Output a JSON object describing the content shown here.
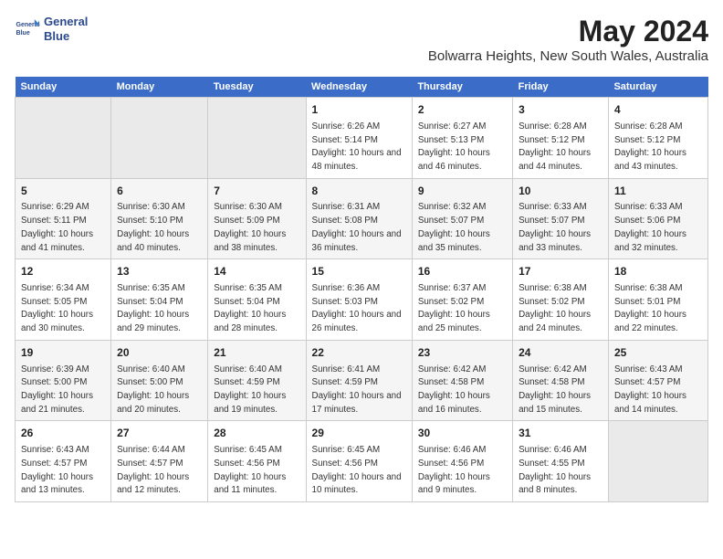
{
  "logo": {
    "line1": "General",
    "line2": "Blue"
  },
  "title": "May 2024",
  "subtitle": "Bolwarra Heights, New South Wales, Australia",
  "days_of_week": [
    "Sunday",
    "Monday",
    "Tuesday",
    "Wednesday",
    "Thursday",
    "Friday",
    "Saturday"
  ],
  "weeks": [
    [
      {
        "day": "",
        "empty": true
      },
      {
        "day": "",
        "empty": true
      },
      {
        "day": "",
        "empty": true
      },
      {
        "day": "1",
        "sunrise": "6:26 AM",
        "sunset": "5:14 PM",
        "daylight": "10 hours and 48 minutes."
      },
      {
        "day": "2",
        "sunrise": "6:27 AM",
        "sunset": "5:13 PM",
        "daylight": "10 hours and 46 minutes."
      },
      {
        "day": "3",
        "sunrise": "6:28 AM",
        "sunset": "5:12 PM",
        "daylight": "10 hours and 44 minutes."
      },
      {
        "day": "4",
        "sunrise": "6:28 AM",
        "sunset": "5:12 PM",
        "daylight": "10 hours and 43 minutes."
      }
    ],
    [
      {
        "day": "5",
        "sunrise": "6:29 AM",
        "sunset": "5:11 PM",
        "daylight": "10 hours and 41 minutes."
      },
      {
        "day": "6",
        "sunrise": "6:30 AM",
        "sunset": "5:10 PM",
        "daylight": "10 hours and 40 minutes."
      },
      {
        "day": "7",
        "sunrise": "6:30 AM",
        "sunset": "5:09 PM",
        "daylight": "10 hours and 38 minutes."
      },
      {
        "day": "8",
        "sunrise": "6:31 AM",
        "sunset": "5:08 PM",
        "daylight": "10 hours and 36 minutes."
      },
      {
        "day": "9",
        "sunrise": "6:32 AM",
        "sunset": "5:07 PM",
        "daylight": "10 hours and 35 minutes."
      },
      {
        "day": "10",
        "sunrise": "6:33 AM",
        "sunset": "5:07 PM",
        "daylight": "10 hours and 33 minutes."
      },
      {
        "day": "11",
        "sunrise": "6:33 AM",
        "sunset": "5:06 PM",
        "daylight": "10 hours and 32 minutes."
      }
    ],
    [
      {
        "day": "12",
        "sunrise": "6:34 AM",
        "sunset": "5:05 PM",
        "daylight": "10 hours and 30 minutes."
      },
      {
        "day": "13",
        "sunrise": "6:35 AM",
        "sunset": "5:04 PM",
        "daylight": "10 hours and 29 minutes."
      },
      {
        "day": "14",
        "sunrise": "6:35 AM",
        "sunset": "5:04 PM",
        "daylight": "10 hours and 28 minutes."
      },
      {
        "day": "15",
        "sunrise": "6:36 AM",
        "sunset": "5:03 PM",
        "daylight": "10 hours and 26 minutes."
      },
      {
        "day": "16",
        "sunrise": "6:37 AM",
        "sunset": "5:02 PM",
        "daylight": "10 hours and 25 minutes."
      },
      {
        "day": "17",
        "sunrise": "6:38 AM",
        "sunset": "5:02 PM",
        "daylight": "10 hours and 24 minutes."
      },
      {
        "day": "18",
        "sunrise": "6:38 AM",
        "sunset": "5:01 PM",
        "daylight": "10 hours and 22 minutes."
      }
    ],
    [
      {
        "day": "19",
        "sunrise": "6:39 AM",
        "sunset": "5:00 PM",
        "daylight": "10 hours and 21 minutes."
      },
      {
        "day": "20",
        "sunrise": "6:40 AM",
        "sunset": "5:00 PM",
        "daylight": "10 hours and 20 minutes."
      },
      {
        "day": "21",
        "sunrise": "6:40 AM",
        "sunset": "4:59 PM",
        "daylight": "10 hours and 19 minutes."
      },
      {
        "day": "22",
        "sunrise": "6:41 AM",
        "sunset": "4:59 PM",
        "daylight": "10 hours and 17 minutes."
      },
      {
        "day": "23",
        "sunrise": "6:42 AM",
        "sunset": "4:58 PM",
        "daylight": "10 hours and 16 minutes."
      },
      {
        "day": "24",
        "sunrise": "6:42 AM",
        "sunset": "4:58 PM",
        "daylight": "10 hours and 15 minutes."
      },
      {
        "day": "25",
        "sunrise": "6:43 AM",
        "sunset": "4:57 PM",
        "daylight": "10 hours and 14 minutes."
      }
    ],
    [
      {
        "day": "26",
        "sunrise": "6:43 AM",
        "sunset": "4:57 PM",
        "daylight": "10 hours and 13 minutes."
      },
      {
        "day": "27",
        "sunrise": "6:44 AM",
        "sunset": "4:57 PM",
        "daylight": "10 hours and 12 minutes."
      },
      {
        "day": "28",
        "sunrise": "6:45 AM",
        "sunset": "4:56 PM",
        "daylight": "10 hours and 11 minutes."
      },
      {
        "day": "29",
        "sunrise": "6:45 AM",
        "sunset": "4:56 PM",
        "daylight": "10 hours and 10 minutes."
      },
      {
        "day": "30",
        "sunrise": "6:46 AM",
        "sunset": "4:56 PM",
        "daylight": "10 hours and 9 minutes."
      },
      {
        "day": "31",
        "sunrise": "6:46 AM",
        "sunset": "4:55 PM",
        "daylight": "10 hours and 8 minutes."
      },
      {
        "day": "",
        "empty": true
      }
    ]
  ],
  "labels": {
    "sunrise_prefix": "Sunrise: ",
    "sunset_prefix": "Sunset: ",
    "daylight_prefix": "Daylight: "
  }
}
